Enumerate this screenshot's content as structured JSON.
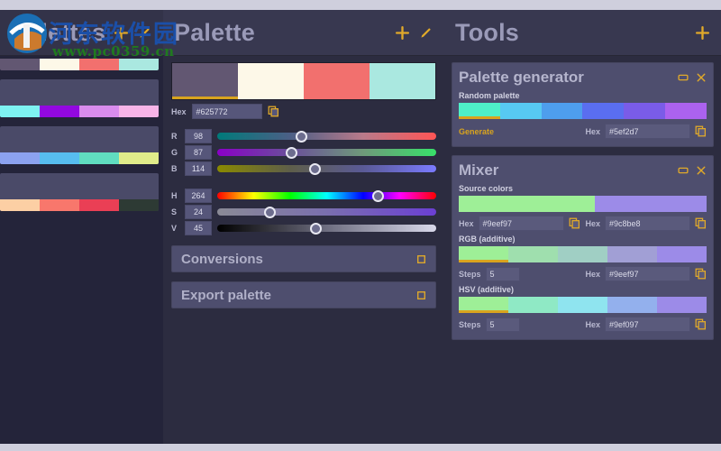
{
  "app": {
    "bg": "#21212e",
    "accent": "#d9a41e"
  },
  "watermark": {
    "cn_text": "河东软件园",
    "url_text": "www.pc0359.cn",
    "cn_color": "#1b4fa8",
    "url_color": "#1f7a1f"
  },
  "sidebar": {
    "title": "Palettes",
    "actions": [
      {
        "name": "add-palette-icon",
        "icon": "plus"
      },
      {
        "name": "edit-palette-icon",
        "icon": "pencil"
      }
    ],
    "cards": [
      {
        "label": "palette-1",
        "colors": [
          "#625772",
          "#fdf8e8",
          "#f2706e",
          "#aae8e0"
        ]
      },
      {
        "label": "palette-2",
        "colors": [
          "#7ef2f2",
          "#9208e0",
          "#d98ced",
          "#f7b4e8"
        ]
      },
      {
        "label": "palette-3",
        "colors": [
          "#8ca2f0",
          "#57bdef",
          "#60ddc0",
          "#e0ec8a"
        ]
      },
      {
        "label": "palette-4",
        "colors": [
          "#fccfa4",
          "#f8776c",
          "#ea3f55",
          "#2d3a34"
        ]
      }
    ]
  },
  "palette": {
    "title": "Palette",
    "actions": [
      {
        "name": "add-color-icon",
        "icon": "plus"
      },
      {
        "name": "edit-color-icon",
        "icon": "pencil"
      }
    ],
    "swatches": [
      {
        "hex": "#625772",
        "selected": true
      },
      {
        "hex": "#fdf8e8",
        "selected": false
      },
      {
        "hex": "#f2706e",
        "selected": false
      },
      {
        "hex": "#aae8e0",
        "selected": false
      }
    ],
    "hex_label": "Hex",
    "hex_value": "#625772",
    "rgb_sliders": [
      {
        "label": "R",
        "value": "98",
        "percent": 38.4,
        "from": "#007a7a",
        "to": "#ff5555"
      },
      {
        "label": "G",
        "value": "87",
        "percent": 34.1,
        "from": "#8a00c8",
        "to": "#38e06a"
      },
      {
        "label": "B",
        "value": "114",
        "percent": 44.7,
        "from": "#8a8a00",
        "to": "#7a7aff"
      }
    ],
    "hsv_sliders": [
      {
        "label": "H",
        "value": "264",
        "percent": 73.3
      },
      {
        "label": "S",
        "value": "24",
        "percent": 24.0,
        "from": "#8a8a96",
        "to": "#6b3fd4"
      },
      {
        "label": "V",
        "value": "45",
        "percent": 45.0,
        "from": "#000000",
        "to": "#d8d8ea"
      }
    ],
    "buttons": [
      {
        "label": "Conversions",
        "name": "conversions-button"
      },
      {
        "label": "Export palette",
        "name": "export-palette-button"
      }
    ]
  },
  "tools": {
    "title": "Tools",
    "actions": [
      {
        "name": "add-tool-icon",
        "icon": "plus"
      }
    ],
    "panels": [
      {
        "name": "palette-generator",
        "title": "Palette generator",
        "section_label": "Random palette",
        "ramp": [
          "#4ef0c8",
          "#57c9f2",
          "#4e9eed",
          "#5a6ef0",
          "#7a5ce8",
          "#ab62ef"
        ],
        "generate_label": "Generate",
        "hex_label": "Hex",
        "hex_value": "#5ef2d7"
      },
      {
        "name": "mixer",
        "title": "Mixer",
        "source_label": "Source colors",
        "source_a": "#9eef97",
        "source_b": "#9c8be8",
        "hex_label": "Hex",
        "source_a_hex": "#9eef97",
        "source_b_hex": "#9c8be8",
        "rgb_label": "RGB (additive)",
        "rgb_ramp": [
          "#9eef97",
          "#9fdfae",
          "#a0cfc4",
          "#a19fd5",
          "#9c8be8"
        ],
        "rgb_steps_label": "Steps",
        "rgb_steps": "5",
        "rgb_hex_label": "Hex",
        "rgb_hex": "#9eef97",
        "hsv_label": "HSV (additive)",
        "hsv_ramp": [
          "#9eef97",
          "#8fe9c5",
          "#8fe4ef",
          "#93b0ed",
          "#9c8be8"
        ],
        "hsv_steps_label": "Steps",
        "hsv_steps": "5",
        "hsv_hex_label": "Hex",
        "hsv_hex": "#9ef097"
      }
    ]
  }
}
